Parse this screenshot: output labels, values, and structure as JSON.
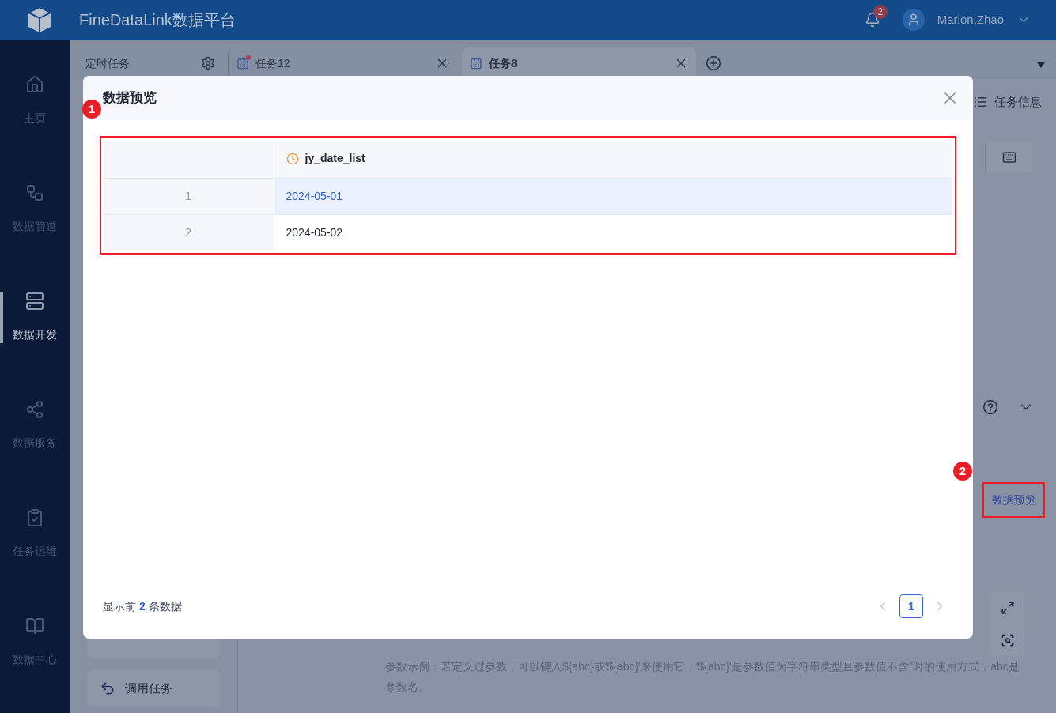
{
  "header": {
    "title": "FineDataLink数据平台",
    "notification_count": "2",
    "user": "Marlon.Zhao"
  },
  "sidebar": {
    "items": [
      {
        "label": "主页",
        "selected": false
      },
      {
        "label": "数据管道",
        "selected": false
      },
      {
        "label": "数据开发",
        "selected": true
      },
      {
        "label": "数据服务",
        "selected": false
      },
      {
        "label": "任务运维",
        "selected": false
      },
      {
        "label": "数据中心",
        "selected": false
      }
    ]
  },
  "tabs": [
    {
      "label": "定时任务",
      "kind": "pinned",
      "selected": false
    },
    {
      "label": "任务12",
      "kind": "task",
      "selected": false,
      "unsaved": true
    },
    {
      "label": "任务8",
      "kind": "task",
      "selected": true,
      "unsaved": false
    }
  ],
  "background": {
    "task_info": "任务信息",
    "left_cards": [
      "调用任务"
    ],
    "data_preview_link": "数据预览",
    "param_hint": "参数示例：若定义过参数，可以键入${abc}或'${abc}'来使用它，'${abc}'是参数值为字符串类型且参数值不含''时的使用方式，abc是参数名。"
  },
  "annotations": [
    "1",
    "2"
  ],
  "modal": {
    "title": "数据预览",
    "columns": [
      {
        "name": "jy_date_list",
        "kind": "date"
      }
    ],
    "rows": [
      {
        "index": "1",
        "cells": [
          "2024-05-01"
        ],
        "selected": true
      },
      {
        "index": "2",
        "cells": [
          "2024-05-02"
        ],
        "selected": false
      }
    ],
    "footer": "显示前 **2** 条数据",
    "pages": [
      {
        "label": "1",
        "selected": true
      }
    ]
  }
}
